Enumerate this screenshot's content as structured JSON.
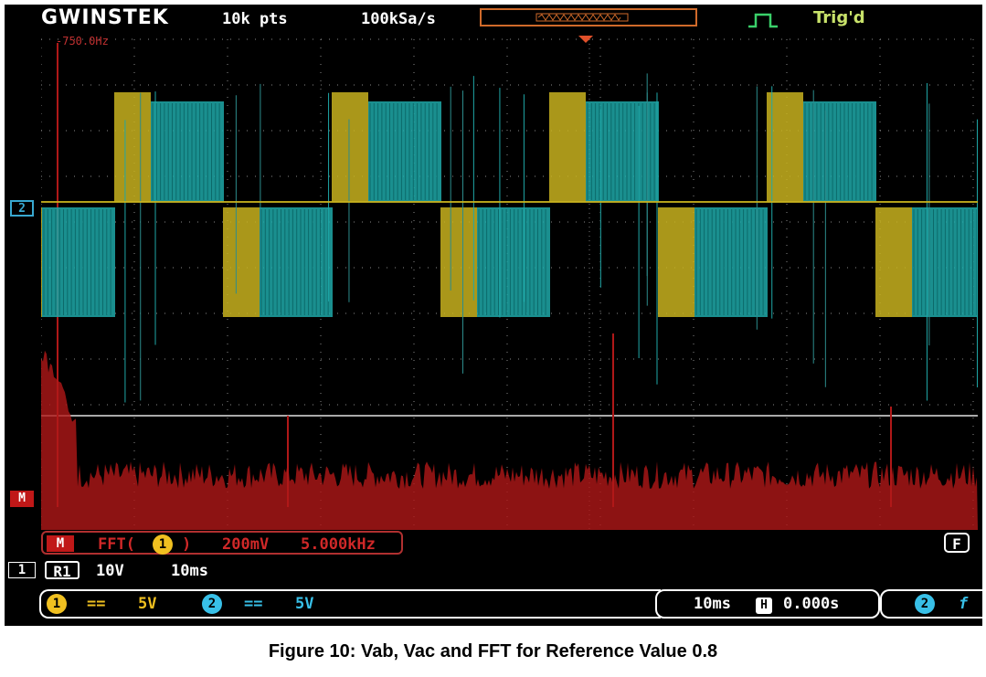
{
  "header": {
    "brand": "GWINSTEK",
    "record_length": "10k pts",
    "sample_rate": "100kSa/s",
    "trigger_status": "Trig'd"
  },
  "grid": {
    "freq_marker": "-750.0Hz"
  },
  "markers": {
    "ch2": "2",
    "math": "M"
  },
  "math_bar": {
    "badge": "M",
    "func": "FFT(",
    "source": "1",
    "func_close": ")",
    "scale": "200mV",
    "span": "5.000kHz",
    "menu_key": "F"
  },
  "ref_bar": {
    "ch_tag": "1",
    "ref_name": "R1",
    "volts": "10V",
    "time": "10ms"
  },
  "status_bar": {
    "ch1_num": "1",
    "ch1_coupling": "==",
    "ch1_scale": "5V",
    "ch2_num": "2",
    "ch2_coupling": "==",
    "ch2_scale": "5V",
    "timebase": "10ms",
    "h_tag": "H",
    "h_pos": "0.000s",
    "trig_src": "2",
    "trig_edge": "f"
  },
  "caption": "Figure 10: Vab, Vac and FFT for Reference Value 0.8",
  "colors": {
    "ch1": "#c8b21e",
    "ch2": "#1fa8a8",
    "math": "#b01818",
    "trig_text": "#c8e26a",
    "grid": "#8a8a8a"
  }
}
